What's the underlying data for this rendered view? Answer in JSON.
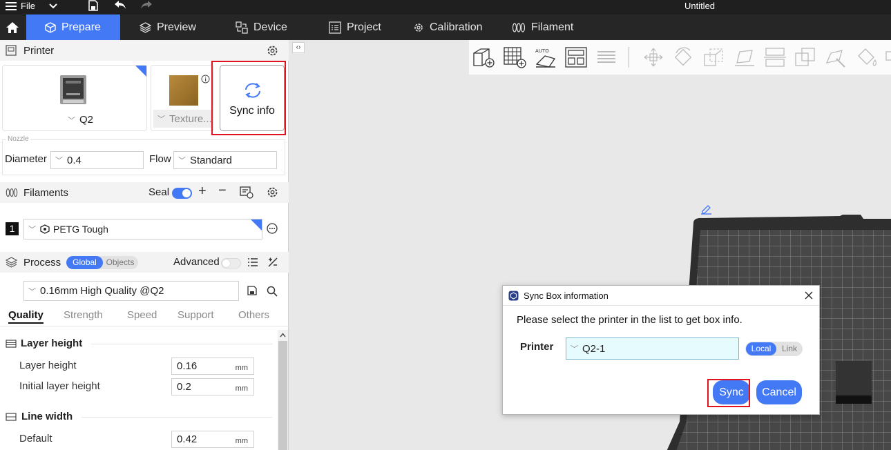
{
  "titlebar": {
    "file_label": "File",
    "title": "Untitled"
  },
  "tabs": [
    {
      "label": "Prepare",
      "icon": "cube-icon"
    },
    {
      "label": "Preview",
      "icon": "layers-icon"
    },
    {
      "label": "Device",
      "icon": "device-icon"
    },
    {
      "label": "Project",
      "icon": "list-icon"
    },
    {
      "label": "Calibration",
      "icon": "gear-icon"
    },
    {
      "label": "Filament",
      "icon": "filament-icon"
    }
  ],
  "printer": {
    "section_title": "Printer",
    "printer_name": "Q2",
    "plate_name": "Texture...",
    "sync_label": "Sync info",
    "nozzle_legend": "Nozzle",
    "diameter_label": "Diameter",
    "diameter_value": "0.4",
    "flow_label": "Flow",
    "flow_value": "Standard"
  },
  "filaments": {
    "section_title": "Filaments",
    "seal_label": "Seal",
    "seal_on": true,
    "items": [
      {
        "index": "1",
        "name": "PETG Tough"
      }
    ]
  },
  "process": {
    "section_title": "Process",
    "toggle_global": "Global",
    "toggle_objects": "Objects",
    "advanced_label": "Advanced",
    "preset": "0.16mm High Quality @Q2",
    "tabs": [
      "Quality",
      "Strength",
      "Speed",
      "Support",
      "Others"
    ],
    "active_tab": "Quality",
    "groups": [
      {
        "title": "Layer height",
        "rows": [
          {
            "label": "Layer height",
            "value": "0.16",
            "unit": "mm"
          },
          {
            "label": "Initial layer height",
            "value": "0.2",
            "unit": "mm"
          }
        ]
      },
      {
        "title": "Line width",
        "rows": [
          {
            "label": "Default",
            "value": "0.42",
            "unit": "mm"
          }
        ]
      }
    ]
  },
  "dialog": {
    "title": "Sync Box information",
    "message": "Please select the printer in the list to get box info.",
    "printer_label": "Printer",
    "printer_value": "Q2-1",
    "toggle_local": "Local",
    "toggle_link": "Link",
    "sync_button": "Sync",
    "cancel_button": "Cancel"
  },
  "colors": {
    "accent": "#4479f6",
    "highlight": "#e3121f",
    "tabbar": "#262626"
  }
}
